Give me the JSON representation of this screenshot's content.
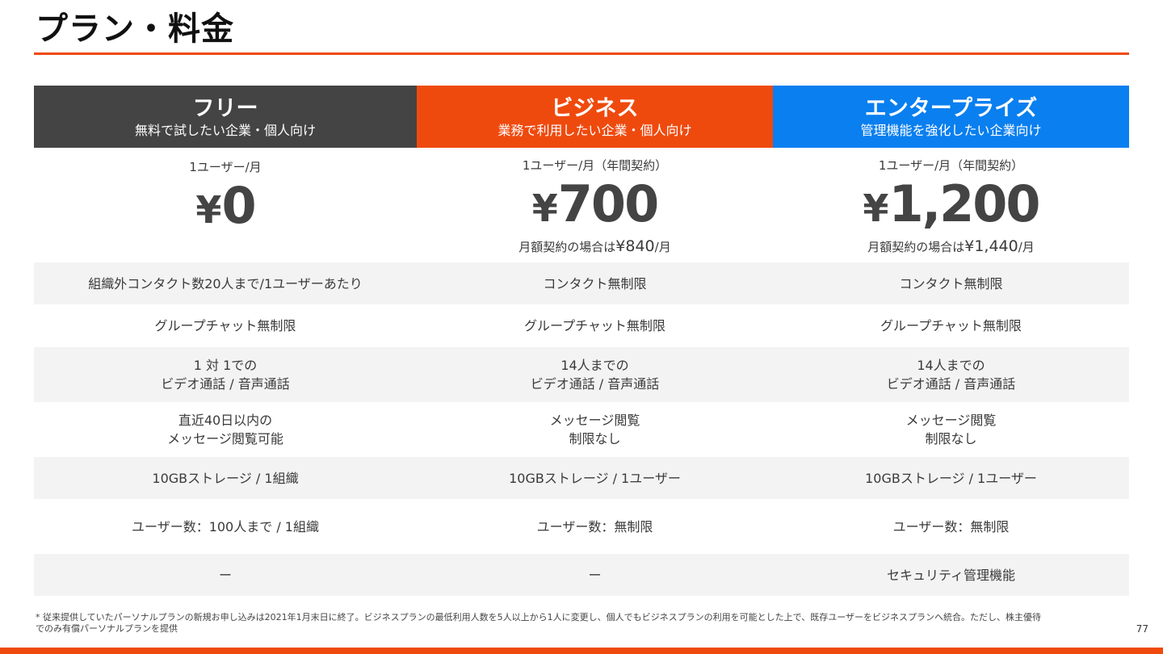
{
  "title": "プラン・料金",
  "plans": [
    {
      "name": "フリー",
      "subtitle": "無料で試したい企業・個人向け",
      "color": "#444444",
      "unit": "1ユーザー/月",
      "yen": "¥",
      "price": "0",
      "monthly_prefix": "",
      "monthly_price": "",
      "monthly_suffix": ""
    },
    {
      "name": "ビジネス",
      "subtitle": "業務で利用したい企業・個人向け",
      "color": "#ef4a0e",
      "unit": "1ユーザー/月（年間契約）",
      "yen": "¥",
      "price": "700",
      "monthly_prefix": "月額契約の場合は",
      "monthly_price": "¥840",
      "monthly_suffix": "/月"
    },
    {
      "name": "エンタープライズ",
      "subtitle": "管理機能を強化したい企業向け",
      "color": "#0a7fef",
      "unit": "1ユーザー/月（年間契約）",
      "yen": "¥",
      "price": "1,200",
      "monthly_prefix": "月額契約の場合は",
      "monthly_price": "¥1,440",
      "monthly_suffix": "/月"
    }
  ],
  "features": [
    [
      "組織外コンタクト数20人まで/1ユーザーあたり",
      "コンタクト無制限",
      "コンタクト無制限"
    ],
    [
      "グループチャット無制限",
      "グループチャット無制限",
      "グループチャット無制限"
    ],
    [
      [
        "1 対 1での",
        "ビデオ通話 / 音声通話"
      ],
      [
        "14人までの",
        "ビデオ通話 / 音声通話"
      ],
      [
        "14人までの",
        "ビデオ通話 / 音声通話"
      ]
    ],
    [
      [
        "直近40日以内の",
        "メッセージ閲覧可能"
      ],
      [
        "メッセージ閲覧",
        "制限なし"
      ],
      [
        "メッセージ閲覧",
        "制限なし"
      ]
    ],
    [
      "10GBストレージ / 1組織",
      "10GBストレージ / 1ユーザー",
      "10GBストレージ / 1ユーザー"
    ],
    [
      "ユーザー数：100人まで / 1組織",
      "ユーザー数：無制限",
      "ユーザー数：無制限"
    ],
    [
      "ー",
      "ー",
      "セキュリティ管理機能"
    ]
  ],
  "footnote": "* 従来提供していたパーソナルプランの新規お申し込みは2021年1月末日に終了。ビジネスプランの最低利用人数を5人以上から1人に変更し、個人でもビジネスプランの利用を可能とした上で、既存ユーザーをビジネスプランへ統合。ただし、株主優待でのみ有償パーソナルプランを提供",
  "page_number": "77",
  "accent_color": "#ef4a0e"
}
